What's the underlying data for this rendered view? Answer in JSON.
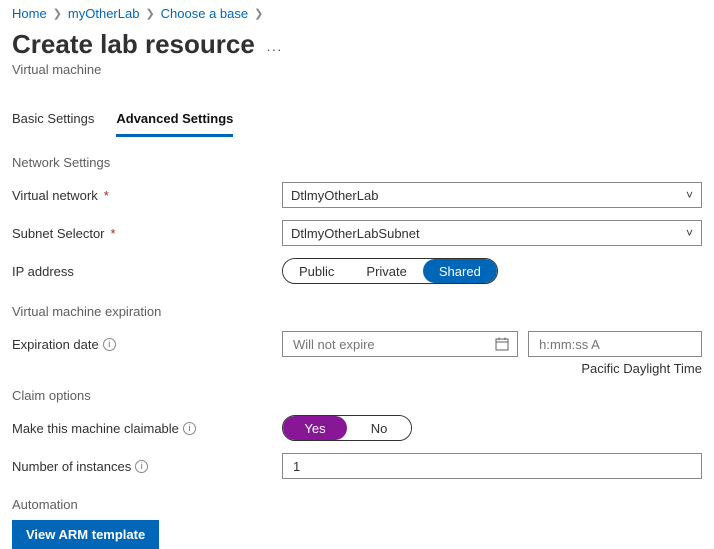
{
  "breadcrumb": {
    "home": "Home",
    "lab": "myOtherLab",
    "choose": "Choose a base"
  },
  "title": "Create lab resource",
  "subtitle": "Virtual machine",
  "tabs": {
    "basic": "Basic Settings",
    "advanced": "Advanced Settings"
  },
  "sections": {
    "network": "Network Settings",
    "expiration": "Virtual machine expiration",
    "claim": "Claim options",
    "automation": "Automation"
  },
  "labels": {
    "vnet": "Virtual network",
    "subnet": "Subnet Selector",
    "ip": "IP address",
    "expdate": "Expiration date",
    "claimable": "Make this machine claimable",
    "instances": "Number of instances"
  },
  "values": {
    "vnet": "DtlmyOtherLab",
    "subnet": "DtlmyOtherLabSubnet",
    "date_placeholder": "Will not expire",
    "time_placeholder": "h:mm:ss A",
    "tz": "Pacific Daylight Time",
    "instances": "1"
  },
  "ip_options": {
    "public": "Public",
    "private": "Private",
    "shared": "Shared"
  },
  "claim_options": {
    "yes": "Yes",
    "no": "No"
  },
  "buttons": {
    "arm": "View ARM template"
  }
}
